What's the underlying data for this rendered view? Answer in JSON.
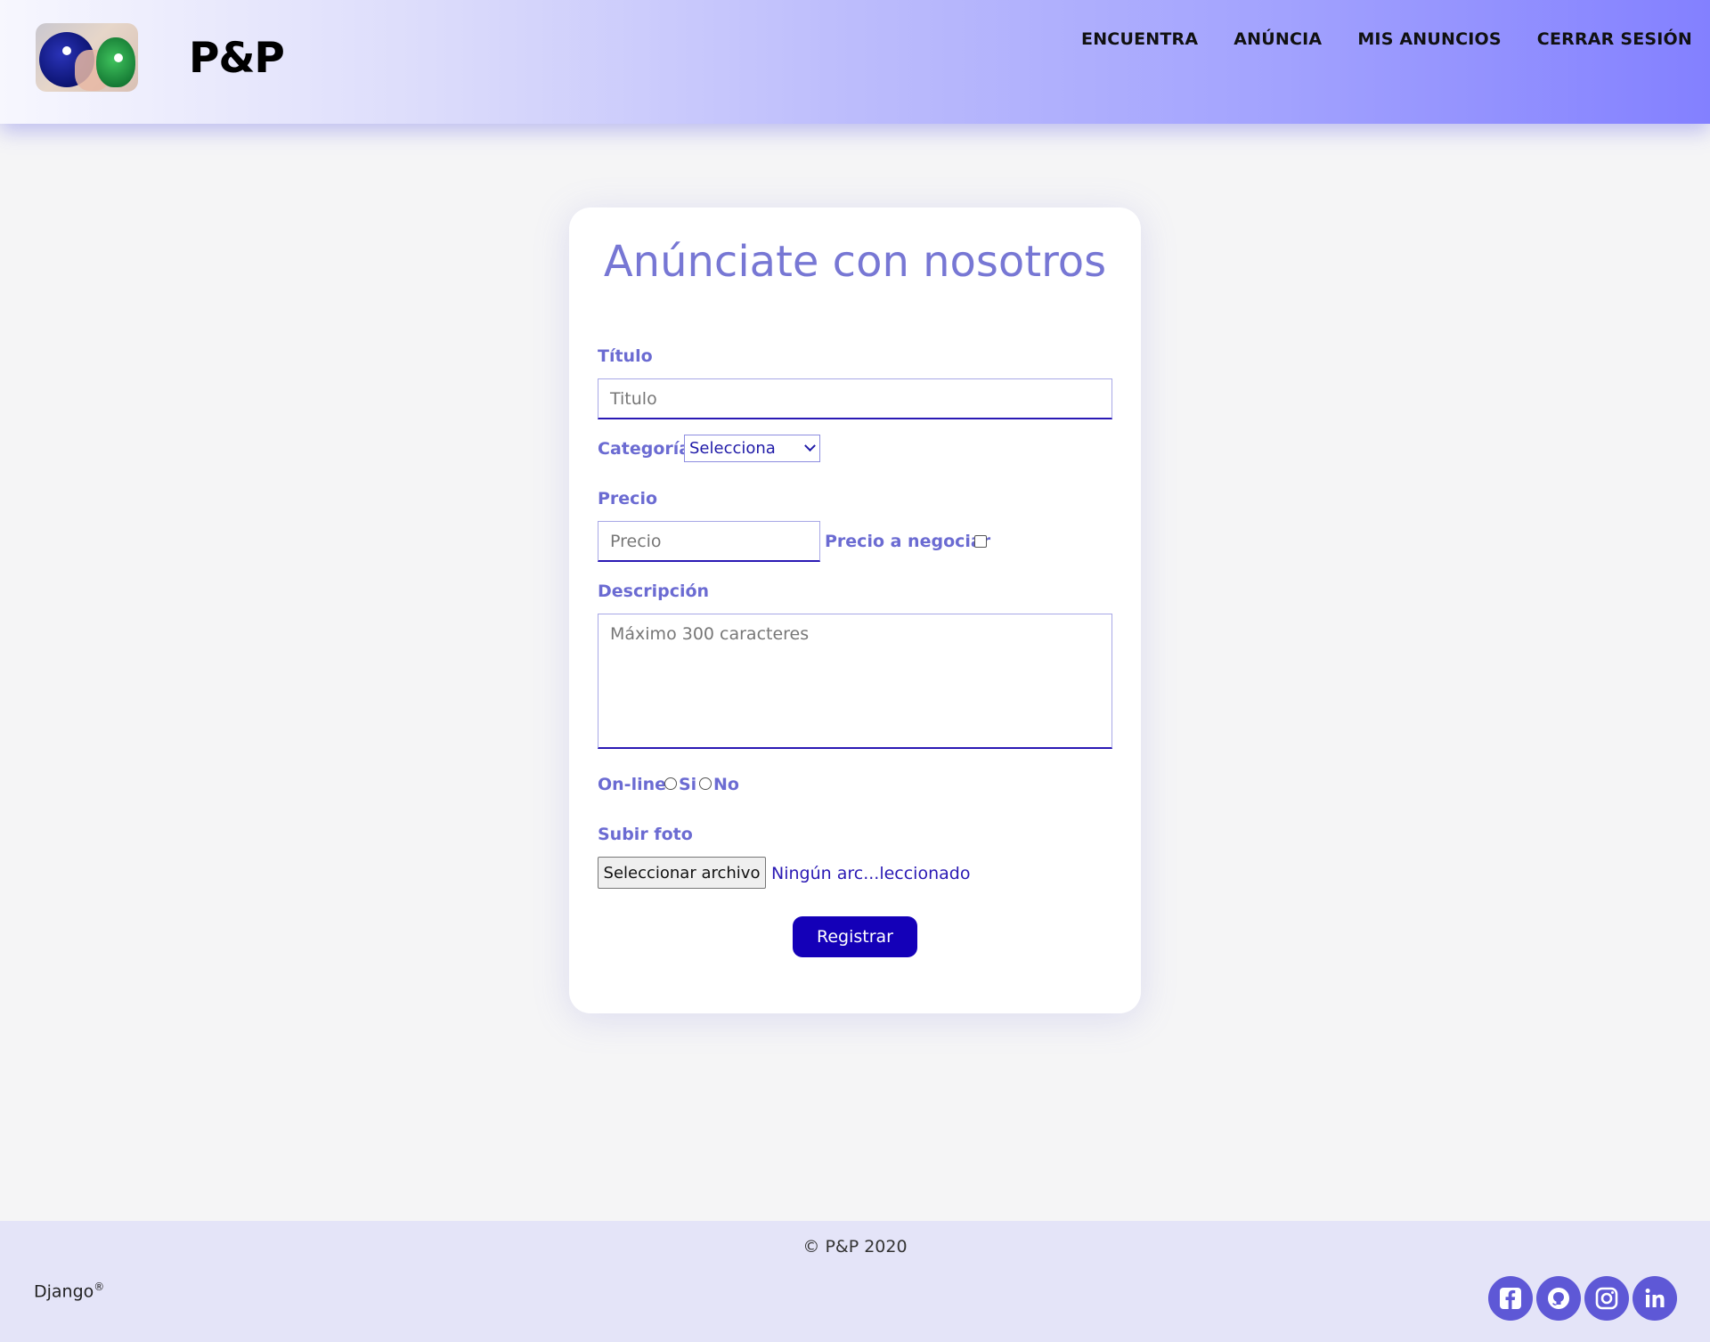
{
  "header": {
    "brand": "P&P",
    "nav": [
      "ENCUENTRA",
      "ANÚNCIA",
      "MIS ANUNCIOS",
      "CERRAR SESIÓN"
    ]
  },
  "form": {
    "title": "Anúnciate con nosotros",
    "titulo_label": "Título",
    "titulo_placeholder": "Titulo",
    "categoria_label": "Categoría",
    "categoria_selected": "Selecciona",
    "precio_label": "Precio",
    "precio_placeholder": "Precio",
    "negociar_label": "Precio a negociar",
    "descripcion_label": "Descripción",
    "descripcion_placeholder": "Máximo 300 caracteres",
    "online_label": "On-line",
    "online_options": [
      "Si",
      "No"
    ],
    "foto_label": "Subir foto",
    "file_button": "Seleccionar archivo",
    "file_status": "Ningún arc...leccionado",
    "submit_label": "Registrar"
  },
  "footer": {
    "copyright": "© P&P 2020",
    "django": "Django",
    "django_mark": "®",
    "social_icons": [
      "facebook-icon",
      "github-icon",
      "instagram-icon",
      "linkedin-icon"
    ]
  },
  "colors": {
    "accent": "#7777d4",
    "primary_button": "#1400b8",
    "social": "#5e58d6",
    "footer_bg": "#e4e4f8"
  }
}
